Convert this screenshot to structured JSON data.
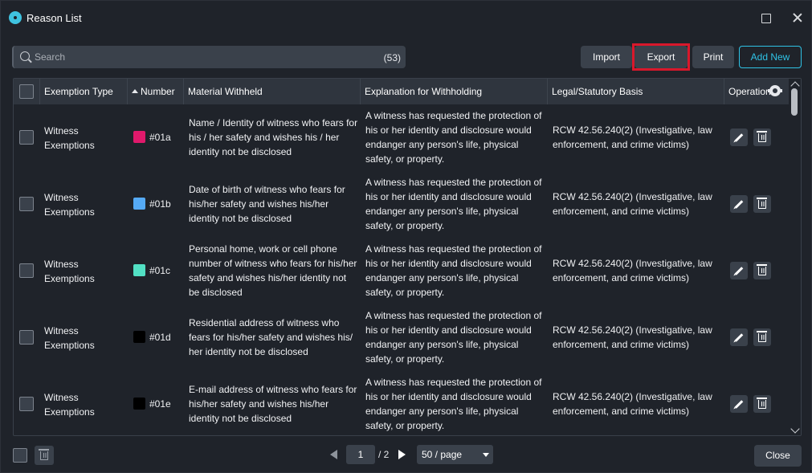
{
  "window": {
    "title": "Reason List"
  },
  "toolbar": {
    "search_placeholder": "Search",
    "count": "(53)",
    "import_label": "Import",
    "export_label": "Export",
    "print_label": "Print",
    "add_label": "Add New"
  },
  "table": {
    "headers": {
      "type": "Exemption Type",
      "number": "Number",
      "material": "Material Withheld",
      "explanation": "Explanation for Withholding",
      "legal": "Legal/Statutory Basis",
      "operation": "Operation"
    },
    "rows": [
      {
        "type": "Witness Exemptions",
        "color": "#e0196b",
        "number": "#01a",
        "material": "Name / Identity of witness who fears for his / her safety and wishes his / her identity not be disclosed",
        "explanation": "A witness has requested the protection of his or her identity and disclosure would endanger any person's life, physical safety, or property.",
        "legal": "RCW 42.56.240(2) (Investigative, law enforcement, and crime victims)"
      },
      {
        "type": "Witness Exemptions",
        "color": "#55aaf5",
        "number": "#01b",
        "material": "Date of birth of witness who fears for his/her safety and wishes his/her identity not be disclosed",
        "explanation": "A witness has requested the protection of his or her identity and disclosure would endanger any person's life, physical safety, or property.",
        "legal": "RCW 42.56.240(2) (Investigative, law enforcement, and crime victims)"
      },
      {
        "type": "Witness Exemptions",
        "color": "#52e0c4",
        "number": "#01c",
        "material": "Personal home, work or cell phone number of witness who fears for his/her safety and wishes his/her identity not be disclosed",
        "explanation": "A witness has requested the protection of his or her identity and disclosure would endanger any person's life, physical safety, or property.",
        "legal": "RCW 42.56.240(2) (Investigative, law enforcement, and crime victims)"
      },
      {
        "type": "Witness Exemptions",
        "color": "#000000",
        "number": "#01d",
        "material": "Residential address of witness who fears for his/her safety and wishes his/ her identity not be disclosed",
        "explanation": "A witness has requested the protection of his or her identity and disclosure would endanger any person's life, physical safety, or property.",
        "legal": "RCW 42.56.240(2) (Investigative, law enforcement, and crime victims)"
      },
      {
        "type": "Witness Exemptions",
        "color": "#000000",
        "number": "#01e",
        "material": "E-mail address of witness who fears for his/her safety and wishes his/her identity not be disclosed",
        "explanation": "A witness has requested the protection of his or her identity and disclosure would endanger any person's life, physical safety, or property.",
        "legal": "RCW 42.56.240(2) (Investigative, law enforcement, and crime victims)"
      }
    ]
  },
  "footer": {
    "page": "1",
    "total_pages": "/ 2",
    "page_size": "50 / page",
    "close_label": "Close"
  },
  "icons": [
    "app-logo-icon",
    "maximize-icon",
    "close-icon",
    "search-icon",
    "sort-up-icon",
    "gear-icon",
    "edit-icon",
    "trash-icon",
    "prev-page-icon",
    "next-page-icon",
    "caret-down-icon"
  ]
}
